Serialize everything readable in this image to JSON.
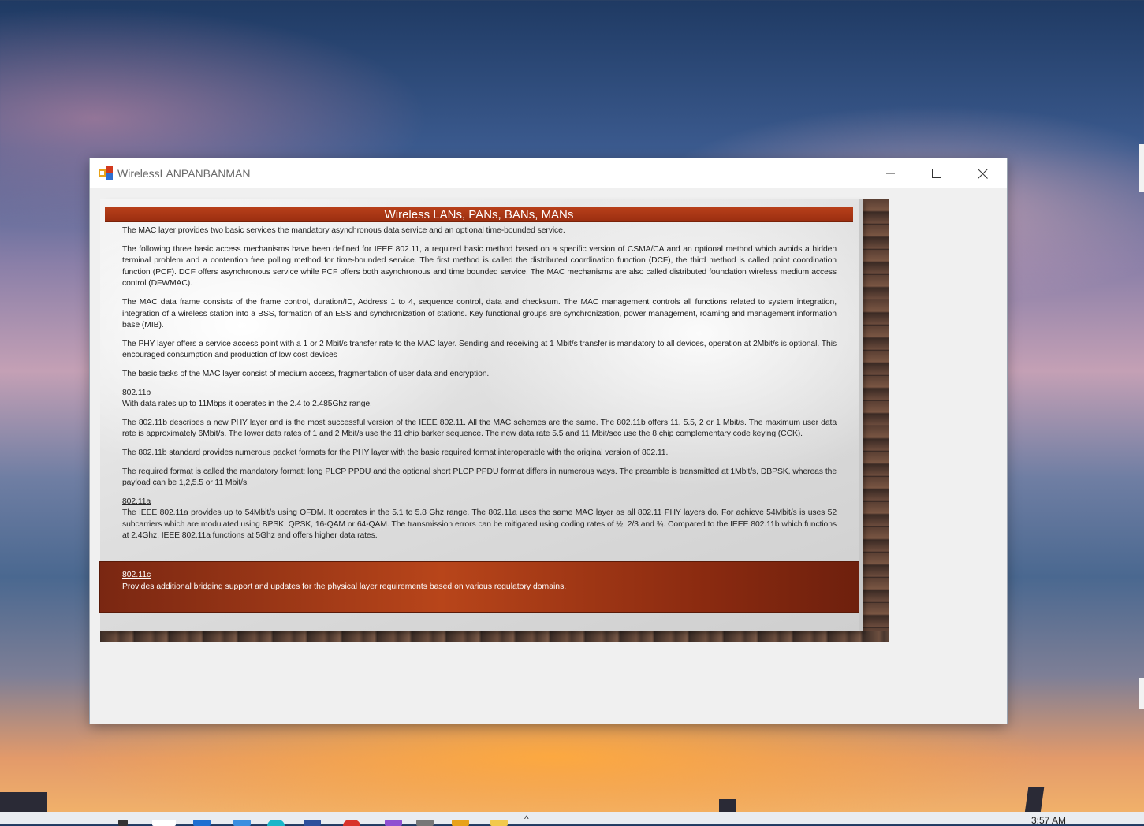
{
  "window": {
    "title": "WirelessLANPANBANMAN"
  },
  "slide": {
    "heading": "Wireless LANs, PANs, BANs, MANs",
    "paragraphs": [
      "The MAC layer provides two basic services the mandatory asynchronous data service and an optional time-bounded service.",
      "The following three basic access mechanisms have been defined for IEEE 802.11, a required basic method based on a specific version of CSMA/CA and an optional method which avoids a hidden terminal problem and a contention free polling method for time-bounded service. The first method is called the distributed coordination function (DCF), the third method is called point coordination function (PCF). DCF offers asynchronous service while PCF offers both asynchronous and time bounded service. The MAC mechanisms are also called distributed foundation wireless medium access control (DFWMAC).",
      "The MAC data frame consists of the frame control, duration/ID, Address 1 to 4, sequence control, data and checksum. The MAC management controls all functions related to system integration, integration of a wireless station into a BSS, formation of an ESS and synchronization of stations. Key functional groups are synchronization, power management, roaming and management information base (MIB).",
      "The PHY layer offers a service access point with a 1 or 2 Mbit/s transfer rate to the MAC layer. Sending and receiving at 1 Mbit/s transfer is mandatory to all devices, operation at 2Mbit/s is optional. This encouraged consumption and production of low cost devices",
      "The basic tasks of the MAC layer consist of medium access, fragmentation of user data and encryption."
    ],
    "section_b": {
      "heading": "802.11b",
      "intro": "With data rates up to 11Mbps it operates in the 2.4 to 2.485Ghz range.",
      "paragraphs": [
        "The 802.11b describes a new PHY layer and is the most successful version of the IEEE 802.11. All the MAC schemes are the same. The 802.11b offers 11, 5.5, 2 or 1 Mbit/s. The maximum user data rate is approximately 6Mbit/s. The lower data rates of 1 and 2 Mbit/s use the 11 chip barker sequence. The new data rate 5.5 and 11 Mbit/sec use the 8 chip complementary code keying (CCK).",
        "The 802.11b standard provides numerous packet formats for the PHY layer with the basic required format interoperable with the original version of 802.11.",
        "The required format is called the mandatory format: long PLCP PPDU and the optional short PLCP PPDU format differs in numerous ways. The preamble is transmitted at 1Mbit/s, DBPSK, whereas the payload can be 1,2,5.5 or 11 Mbit/s."
      ]
    },
    "section_a": {
      "heading": "802.11a",
      "text": "The IEEE 802.11a provides up to 54Mbit/s using OFDM. It operates in the 5.1 to 5.8 Ghz range. The 802.11a uses the same MAC layer as all 802.11 PHY layers do. For achieve 54Mbit/s is uses 52 subcarriers which are modulated using BPSK, QPSK, 16-QAM or 64-QAM. The transmission errors can be mitigated using coding rates of ½, 2/3 and ¾. Compared to the IEEE 802.11b which functions at 2.4Ghz, IEEE 802.11a functions at 5Ghz and offers higher data rates."
    },
    "section_c": {
      "heading": "802.11c",
      "text": "Provides additional bridging support and updates for the physical layer requirements based on various regulatory domains."
    }
  },
  "taskbar": {
    "clock": "3:57 AM"
  },
  "colors": {
    "header_band": "#b8401a",
    "footer_band": "#a83a16",
    "window_bg": "#f0f0f0"
  }
}
